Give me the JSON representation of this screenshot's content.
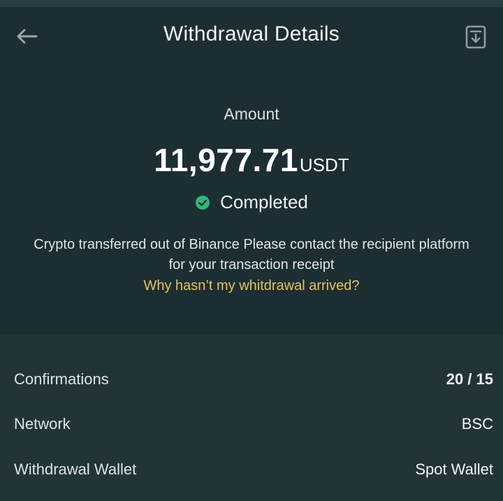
{
  "header": {
    "title": "Withdrawal Details",
    "back_icon": "arrow-left-icon",
    "download_icon": "download-receipt-icon"
  },
  "hero": {
    "amount_label": "Amount",
    "amount_value": "11,977.71",
    "amount_unit": "USDT",
    "status": "Completed",
    "status_icon": "check-circle-icon",
    "info_text": "Crypto transferred out of Binance Please contact the recipient platform for your transaction receipt",
    "help_link": "Why hasn’t my whitdrawal arrived?"
  },
  "details": {
    "rows": [
      {
        "label": "Confirmations",
        "value": "20 / 15"
      },
      {
        "label": "Network",
        "value": "BSC"
      },
      {
        "label": "Withdrawal Wallet",
        "value": "Spot Wallet"
      }
    ]
  },
  "colors": {
    "background": "#1d2e33",
    "details_background": "#233437",
    "status_green": "#2eb67d",
    "link_yellow": "#e5c262"
  }
}
